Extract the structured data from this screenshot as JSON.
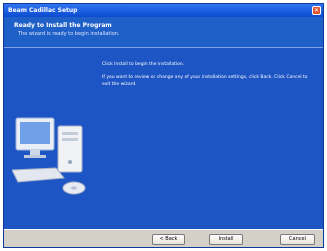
{
  "window": {
    "title": "Beam Cadillac Setup"
  },
  "header": {
    "title": "Ready to Install the Program",
    "subtitle": "The wizard is ready to begin installation."
  },
  "body": {
    "line1": "Click Install to begin the installation.",
    "line2": "If you want to review or change any of your installation settings, click Back. Click Cancel to exit the wizard."
  },
  "buttons": {
    "back": "< Back",
    "install": "Install",
    "cancel": "Cancel"
  },
  "colors": {
    "titlebar": "#0b4bd0",
    "panel": "#1d56c4",
    "close": "#e2542f"
  },
  "icons": {
    "close": "close-icon",
    "art": "computer-illustration"
  }
}
